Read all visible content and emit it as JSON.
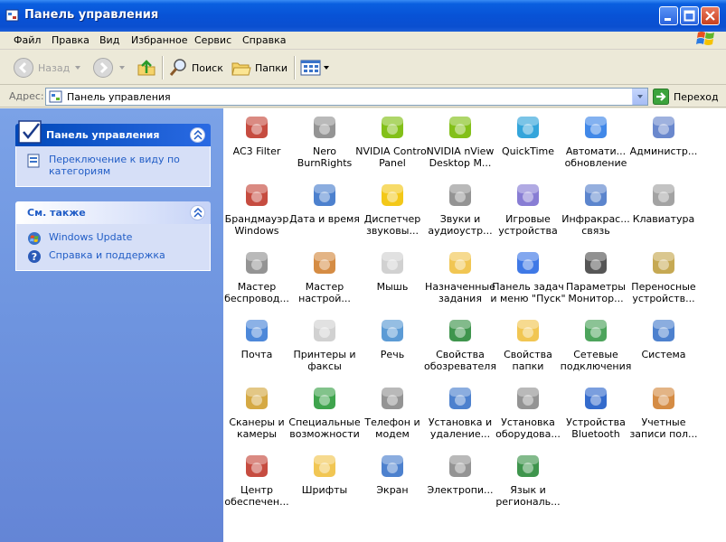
{
  "window": {
    "title": "Панель управления"
  },
  "menu": [
    "Файл",
    "Правка",
    "Вид",
    "Избранное",
    "Сервис",
    "Справка"
  ],
  "toolbar": {
    "back_label": "Назад",
    "search_label": "Поиск",
    "folders_label": "Папки"
  },
  "address": {
    "label": "Адрес:",
    "value": "Панель управления",
    "go_label": "Переход"
  },
  "leftpane": {
    "cp_panel": {
      "title": "Панель управления",
      "links": [
        {
          "label": "Переключение к виду по категориям",
          "icon": "category-view-icon"
        }
      ]
    },
    "see_also": {
      "title": "См. также",
      "links": [
        {
          "label": "Windows Update",
          "icon": "windows-update-icon"
        },
        {
          "label": "Справка и поддержка",
          "icon": "help-icon"
        }
      ]
    }
  },
  "items": [
    {
      "label": "AC3 Filter",
      "icon": "ac3-filter-icon",
      "color": "#c0392b"
    },
    {
      "label": "Nero BurnRights",
      "icon": "nero-lock-icon",
      "color": "#888888"
    },
    {
      "label": "NVIDIA Control Panel",
      "icon": "nvidia-icon",
      "color": "#76b900"
    },
    {
      "label": "NVIDIA nView Desktop M...",
      "icon": "nvidia-nview-icon",
      "color": "#76b900"
    },
    {
      "label": "QuickTime",
      "icon": "quicktime-icon",
      "color": "#1e9bd7"
    },
    {
      "label": "Автомати... обновление",
      "icon": "automatic-updates-icon",
      "color": "#2c7be5"
    },
    {
      "label": "Админис­тр...",
      "icon": "admin-tools-icon",
      "color": "#5a7bc8"
    },
    {
      "label": "Брандмауэр Windows",
      "icon": "firewall-icon",
      "color": "#c0392b"
    },
    {
      "label": "Дата и время",
      "icon": "date-time-icon",
      "color": "#3a73c9"
    },
    {
      "label": "Диспетчер звуковы...",
      "icon": "sound-manager-icon",
      "color": "#f2c200"
    },
    {
      "label": "Звуки и аудиоустр...",
      "icon": "sounds-audio-icon",
      "color": "#888888"
    },
    {
      "label": "Игровые устройства",
      "icon": "game-controllers-icon",
      "color": "#7b6fcf"
    },
    {
      "label": "Инфракрас... связь",
      "icon": "infrared-icon",
      "color": "#4a78c8"
    },
    {
      "label": "Клавиатура",
      "icon": "keyboard-icon",
      "color": "#999999"
    },
    {
      "label": "Мастер беспровод...",
      "icon": "wireless-wizard-icon",
      "color": "#888888"
    },
    {
      "label": "Мастер настрой...",
      "icon": "network-setup-icon",
      "color": "#d08030"
    },
    {
      "label": "Мышь",
      "icon": "mouse-icon",
      "color": "#cccccc"
    },
    {
      "label": "Назначенные задания",
      "icon": "scheduled-tasks-icon",
      "color": "#f0c040"
    },
    {
      "label": "Панель задач и меню \"Пуск\"",
      "icon": "taskbar-start-icon",
      "color": "#2a6ae3"
    },
    {
      "label": "Параметры Монитор...",
      "icon": "monitor-params-icon",
      "color": "#444444"
    },
    {
      "label": "Переносные устройств...",
      "icon": "portable-devices-icon",
      "color": "#c0a040"
    },
    {
      "label": "Почта",
      "icon": "mail-icon",
      "color": "#3a7bd5"
    },
    {
      "label": "Принтеры и факсы",
      "icon": "printers-icon",
      "color": "#cccccc"
    },
    {
      "label": "Речь",
      "icon": "speech-icon",
      "color": "#4a90d0"
    },
    {
      "label": "Свойства обозревателя",
      "icon": "internet-options-icon",
      "color": "#2a8a3a"
    },
    {
      "label": "Свойства папки",
      "icon": "folder-options-icon",
      "color": "#f0c040"
    },
    {
      "label": "Сетевые подключения",
      "icon": "network-connections-icon",
      "color": "#3a9a4a"
    },
    {
      "label": "Система",
      "icon": "system-icon",
      "color": "#3a73c9"
    },
    {
      "label": "Сканеры и камеры",
      "icon": "scanners-cameras-icon",
      "color": "#d0a030"
    },
    {
      "label": "Специальные возможности",
      "icon": "accessibility-icon",
      "color": "#2a9a3a"
    },
    {
      "label": "Телефон и модем",
      "icon": "phone-modem-icon",
      "color": "#888888"
    },
    {
      "label": "Установка и удаление...",
      "icon": "add-remove-programs-icon",
      "color": "#3a73c9"
    },
    {
      "label": "Установка оборудова...",
      "icon": "add-hardware-icon",
      "color": "#888888"
    },
    {
      "label": "Устройства Bluetooth",
      "icon": "bluetooth-icon",
      "color": "#1e5bc6"
    },
    {
      "label": "Учетные записи пол...",
      "icon": "user-accounts-icon",
      "color": "#d08030"
    },
    {
      "label": "Центр обеспечен...",
      "icon": "security-center-icon",
      "color": "#c0392b"
    },
    {
      "label": "Шрифты",
      "icon": "fonts-icon",
      "color": "#f0c040"
    },
    {
      "label": "Экран",
      "icon": "display-icon",
      "color": "#3a73c9"
    },
    {
      "label": "Электропи...",
      "icon": "power-options-icon",
      "color": "#888888"
    },
    {
      "label": "Язык и региональ...",
      "icon": "regional-options-icon",
      "color": "#2a8a3a"
    }
  ]
}
